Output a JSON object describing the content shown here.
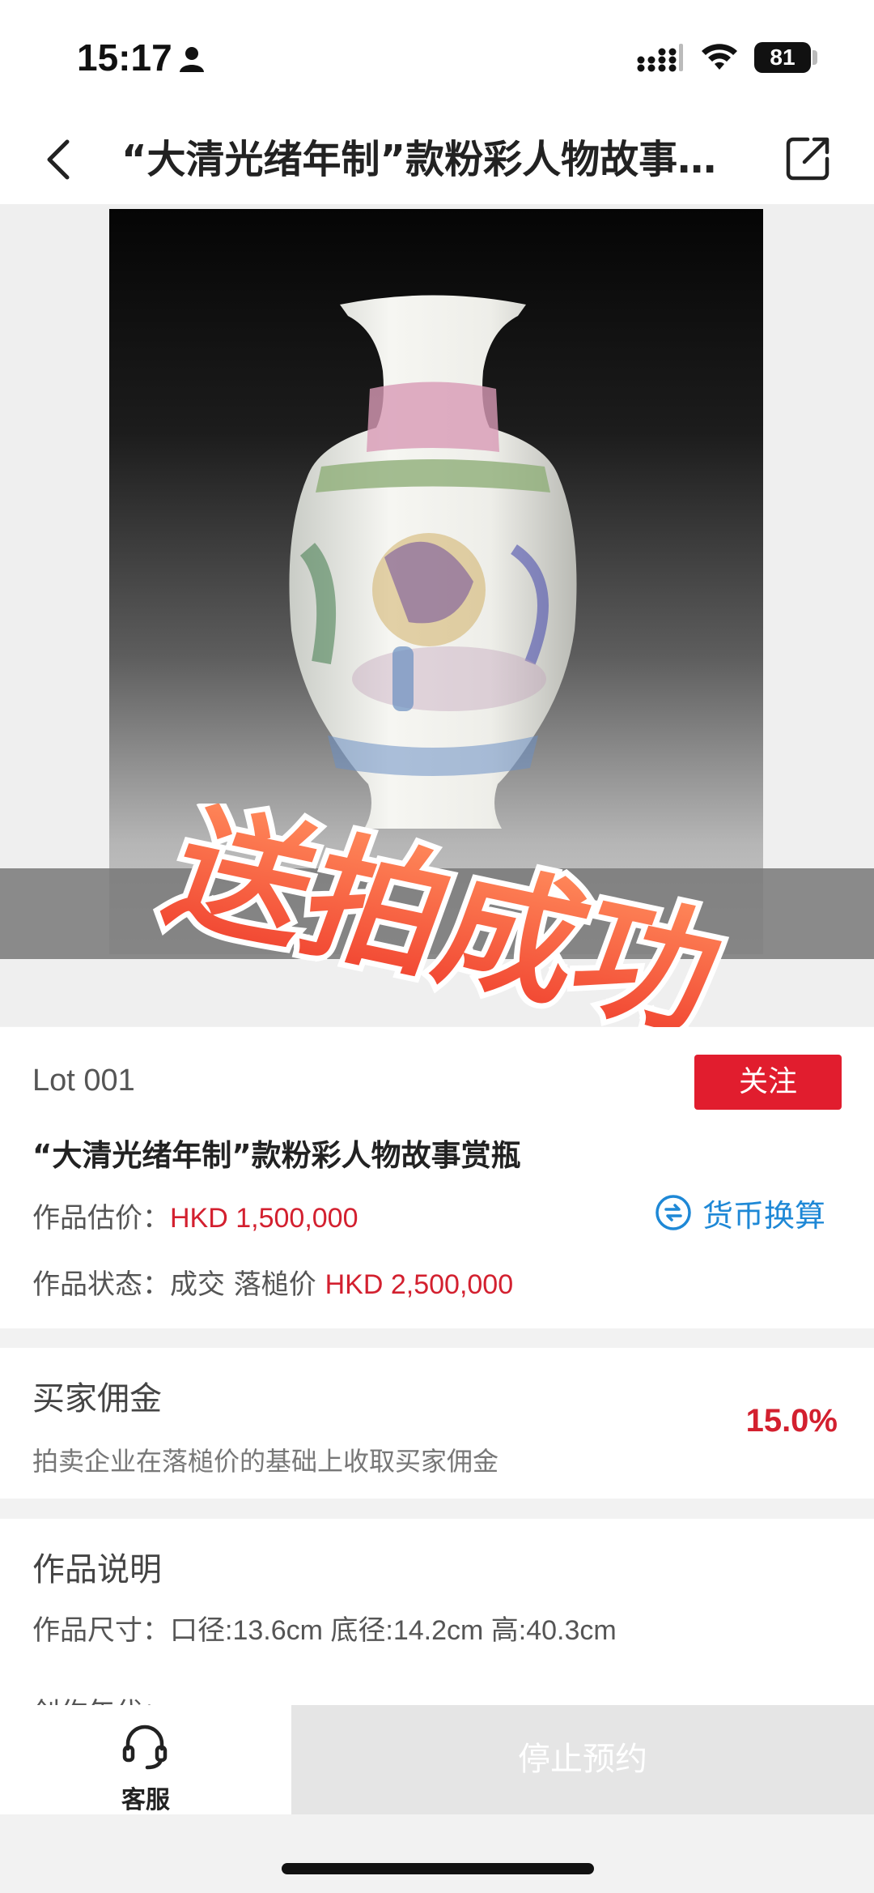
{
  "status_bar": {
    "time": "15:17",
    "battery": "81",
    "icons": [
      "person-icon",
      "signal-icon",
      "wifi-icon",
      "battery-icon"
    ]
  },
  "nav": {
    "title": "“大清光绪年制”款粉彩人物故事赏瓶",
    "back_icon": "chevron-left-icon",
    "share_icon": "share-icon"
  },
  "hero": {
    "stamp_text": "送拍成功"
  },
  "lot": {
    "number": "Lot 001",
    "follow_label": "关注",
    "title": "“大清光绪年制”款粉彩人物故事赏瓶",
    "estimate_label": "作品估价：",
    "estimate_value": "HKD 1,500,000",
    "currency_label": "货币换算",
    "status_label": "作品状态：",
    "status_value": "成交 落槌价",
    "hammer_price": "HKD 2,500,000"
  },
  "commission": {
    "title": "买家佣金",
    "description": "拍卖企业在落槌价的基础上收取买家佣金",
    "rate": "15.0%"
  },
  "description": {
    "title": "作品说明",
    "size_label": "作品尺寸：",
    "size_value": "口径:13.6cm 底径:14.2cm 高:40.3cm",
    "next_label": "创作年代："
  },
  "bottom": {
    "service_label": "客服",
    "stop_label": "停止预约"
  },
  "colors": {
    "accent_red": "#e11d2e",
    "price_red": "#d3202f",
    "link_blue": "#1e88d6"
  }
}
